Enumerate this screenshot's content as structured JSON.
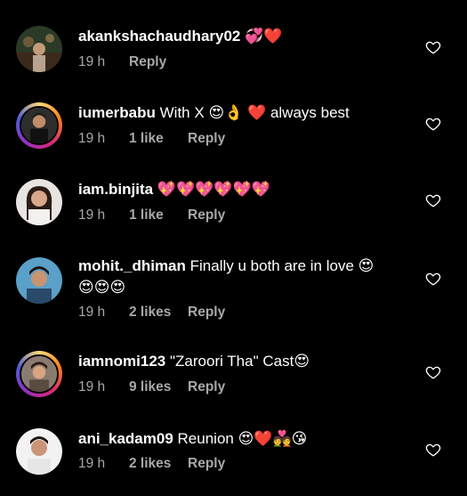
{
  "comments": [
    {
      "username": "akankshachaudhary02",
      "text": "",
      "emoji": "💞❤️",
      "time": "19 h",
      "likes": "",
      "reply": "Reply"
    },
    {
      "username": "iumerbabu",
      "text": "With X",
      "emoji": "😍👌 ❤️",
      "text_after": "always best",
      "time": "19 h",
      "likes": "1 like",
      "reply": "Reply"
    },
    {
      "username": "iam.binjita",
      "text": "",
      "emoji": "💖💖💖💖💖💖",
      "time": "19 h",
      "likes": "1 like",
      "reply": "Reply"
    },
    {
      "username": "mohit._dhiman",
      "text": "Finally u both are in love",
      "emoji": "😍",
      "line2": "😍😍😍",
      "time": "19 h",
      "likes": "2 likes",
      "reply": "Reply"
    },
    {
      "username": "iamnomi123",
      "text": "\"Zaroori Tha\" Cast",
      "emoji": "😍",
      "time": "19 h",
      "likes": "9 likes",
      "reply": "Reply"
    },
    {
      "username": "ani_kadam09",
      "text": "Reunion",
      "emoji": "😍❤️💑😘",
      "time": "19 h",
      "likes": "2 likes",
      "reply": "Reply"
    }
  ],
  "icons": {
    "like": "heart-outline-icon"
  },
  "colors": {
    "background": "#000000",
    "text": "#ffffff",
    "meta": "#a8a8a8"
  }
}
